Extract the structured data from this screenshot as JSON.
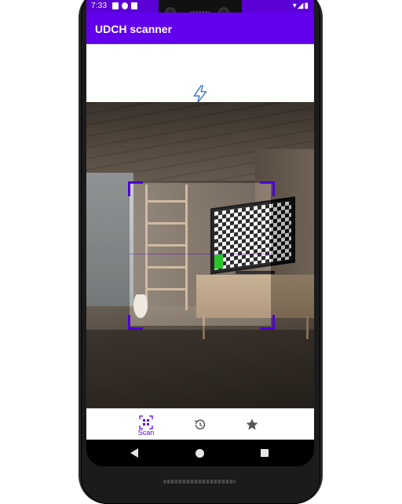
{
  "status_bar": {
    "time": "7:33",
    "notification_icons": [
      "a-icon",
      "p-icon",
      "sim-icon"
    ],
    "right_icons": "▾◢▮"
  },
  "app_bar": {
    "title": "UDCH scanner"
  },
  "flash_toggle": {
    "icon": "flash-off-icon"
  },
  "scanner": {
    "viewfinder_icon": "scan-frame",
    "laser_color": "#6200ee"
  },
  "bottom_nav": {
    "items": [
      {
        "label": "Scan",
        "icon": "qr-scan-icon",
        "selected": true
      },
      {
        "label": "",
        "icon": "history-icon",
        "selected": false
      },
      {
        "label": "",
        "icon": "star-icon",
        "selected": false
      }
    ]
  },
  "system_nav": {
    "back": "back-icon",
    "home": "home-icon",
    "recents": "recents-icon"
  },
  "colors": {
    "primary": "#6200ee",
    "status_bar": "#5a00d6",
    "accent_green": "#11c011"
  }
}
